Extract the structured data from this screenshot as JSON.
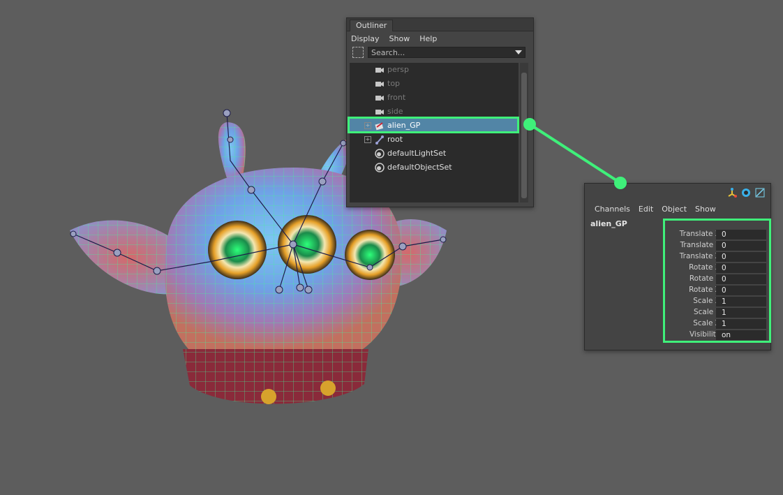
{
  "outliner": {
    "tab_label": "Outliner",
    "menu": [
      "Display",
      "Show",
      "Help"
    ],
    "search_placeholder": "Search...",
    "items": [
      {
        "label": "persp",
        "icon": "camera-icon",
        "dim": true
      },
      {
        "label": "top",
        "icon": "camera-icon",
        "dim": true
      },
      {
        "label": "front",
        "icon": "camera-icon",
        "dim": true
      },
      {
        "label": "side",
        "icon": "camera-icon",
        "dim": true
      },
      {
        "label": "alien_GP",
        "icon": "geometry-proxy-icon",
        "selected": true,
        "expandable": true
      },
      {
        "label": "root",
        "icon": "joint-icon",
        "expandable": true
      },
      {
        "label": "defaultLightSet",
        "icon": "set-icon"
      },
      {
        "label": "defaultObjectSet",
        "icon": "set-icon"
      }
    ]
  },
  "channel_box": {
    "menu": [
      "Channels",
      "Edit",
      "Object",
      "Show"
    ],
    "object_name": "alien_GP",
    "attributes": [
      {
        "name": "Translate X",
        "value": "0"
      },
      {
        "name": "Translate Y",
        "value": "0"
      },
      {
        "name": "Translate Z",
        "value": "0"
      },
      {
        "name": "Rotate X",
        "value": "0"
      },
      {
        "name": "Rotate Y",
        "value": "0"
      },
      {
        "name": "Rotate Z",
        "value": "0"
      },
      {
        "name": "Scale X",
        "value": "1"
      },
      {
        "name": "Scale Y",
        "value": "1"
      },
      {
        "name": "Scale Z",
        "value": "1"
      },
      {
        "name": "Visibility",
        "value": "on"
      }
    ],
    "icons": [
      "axis-icon",
      "rig-icon",
      "graph-icon"
    ]
  },
  "colors": {
    "viewport_bg": "#5d5d5d",
    "highlight": "#3ff07a",
    "selection": "#5285a6"
  }
}
